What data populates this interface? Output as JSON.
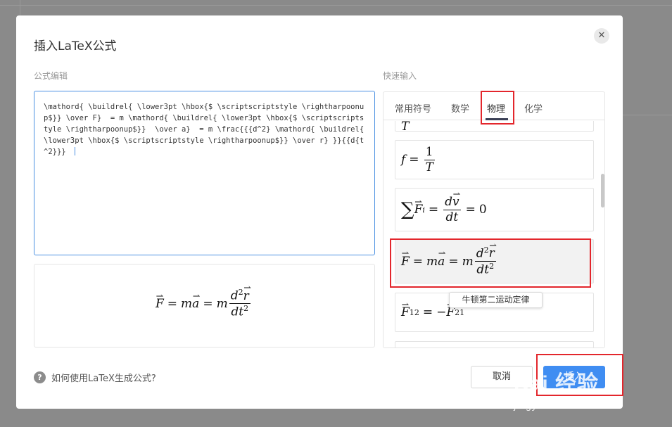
{
  "dialog": {
    "title": "插入LaTeX公式",
    "close_icon": "close-icon"
  },
  "editor": {
    "label": "公式编辑",
    "value": "\\mathord{ \\buildrel{ \\lower3pt \\hbox{$ \\scriptscriptstyle \\rightharpoonup$}} \\over F}  = m \\mathord{ \\buildrel{ \\lower3pt \\hbox{$ \\scriptscriptstyle \\rightharpoonup$}}  \\over a}  = m \\frac{{{d^2} \\mathord{ \\buildrel{ \\lower3pt \\hbox{$ \\scriptscriptstyle \\rightharpoonup$}} \\over r} }}{{d{t^2}}} "
  },
  "quick_input": {
    "label": "快速输入",
    "tabs": [
      {
        "label": "常用符号",
        "active": false
      },
      {
        "label": "数学",
        "active": false
      },
      {
        "label": "物理",
        "active": true
      },
      {
        "label": "化学",
        "active": false
      }
    ],
    "tooltip": "牛顿第二运动定律"
  },
  "footer": {
    "help_icon": "question-icon",
    "help_text": "如何使用LaTeX生成公式?",
    "cancel_label": "取消",
    "insert_label": "插入"
  },
  "watermark": {
    "main": "Bai 经验",
    "sub": "jingyan.baidu.com"
  },
  "colors": {
    "accent": "#3f8df2",
    "highlight": "#e3262c",
    "editor_border": "#4a90e2"
  }
}
